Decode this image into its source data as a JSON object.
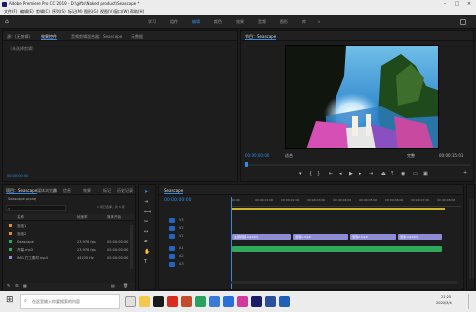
{
  "window": {
    "title": "Adobe Premiere Pro CC 2019 - D:\\gifts\\Naked product\\Seascape *",
    "controls": [
      "–",
      "□",
      "×"
    ]
  },
  "menu": [
    "文件(F)",
    "编辑(E)",
    "剪辑(C)",
    "序列(S)",
    "标记(M)",
    "图形(G)",
    "视图(V)",
    "窗口(W)",
    "帮助(H)"
  ],
  "workspace": {
    "home_icon": "home-icon",
    "tabs": [
      "学习",
      "组件",
      "编辑",
      "颜色",
      "效果",
      "音频",
      "图形",
      "库"
    ],
    "active": "编辑",
    "more": "»"
  },
  "source_panel": {
    "tabs": [
      "源：(无剪辑)",
      "效果控件",
      "音频剪辑混合器：Seascape",
      "元数据"
    ],
    "active_tab": "效果控件",
    "placeholder": "（未选择剪辑）",
    "timecode": "00:00:00:00"
  },
  "program_panel": {
    "title": "节目：Seascape",
    "timecode": "00:00:00:00",
    "fit": "适合",
    "quality": "完整",
    "duration": "00:00:15:01",
    "transport_icons": [
      "marker-icon",
      "in-point-icon",
      "out-point-icon",
      "go-to-in-icon",
      "step-back-icon",
      "play-icon",
      "step-forward-icon",
      "go-to-out-icon",
      "lift-icon",
      "extract-icon",
      "export-frame-icon",
      "compare-icon",
      "settings-icon"
    ]
  },
  "project_panel": {
    "tabs": [
      "项目：Seascape",
      "媒体浏览器",
      "库",
      "信息",
      "效果",
      "标记",
      "历史记录"
    ],
    "project_name": "Seascape.prproj",
    "items_selected": "1 项已选择，共 5 项",
    "columns": [
      "名称",
      "帧速率",
      "媒体开始"
    ],
    "items": [
      {
        "name": "泡泡1",
        "color": "#e28f2a",
        "fps": "",
        "start": ""
      },
      {
        "name": "泡泡2",
        "color": "#e28f2a",
        "fps": "",
        "start": ""
      },
      {
        "name": "Seascape",
        "color": "#2fa95a",
        "fps": "23.976 fps",
        "start": "00:00:00:00"
      },
      {
        "name": "开幕.mp3",
        "color": "#2fa95a",
        "fps": "23.976 fps",
        "start": "00:00:00:00"
      },
      {
        "name": "IMG 打工素材 mp4",
        "color": "#8f8cd6",
        "fps": "44100 Hz",
        "start": "00:00:00:00"
      }
    ]
  },
  "timeline": {
    "title": "Seascape",
    "timecode": "00:00:00:00",
    "ruler_labels": [
      "00:00",
      "00:00:01:00",
      "00:00:02:00",
      "00:00:03:00",
      "00:00:04:00",
      "00:00:05:00",
      "00:00:06:00",
      "00:00:07:00",
      "00:00:08:00"
    ],
    "video_tracks": [
      "V3",
      "V2",
      "V1"
    ],
    "audio_tracks": [
      "A1",
      "A2",
      "A3"
    ],
    "clips": [
      {
        "track": "V1",
        "label": "主题视频.mp4[V]",
        "start": 0.0,
        "end": 0.28
      },
      {
        "track": "V1",
        "label": "泡泡1.mp4",
        "start": 0.29,
        "end": 0.55
      },
      {
        "track": "V1",
        "label": "泡泡2.mp4",
        "start": 0.56,
        "end": 0.78
      },
      {
        "track": "V1",
        "label": "泡沫.mp4[V]",
        "start": 0.79,
        "end": 1.0
      },
      {
        "track": "A1",
        "label": "",
        "start": 0.0,
        "end": 1.0
      }
    ]
  },
  "taskbar": {
    "search_placeholder": "在这里输入你要搜索的内容",
    "time": "21:25",
    "date": "2020/3/4"
  }
}
